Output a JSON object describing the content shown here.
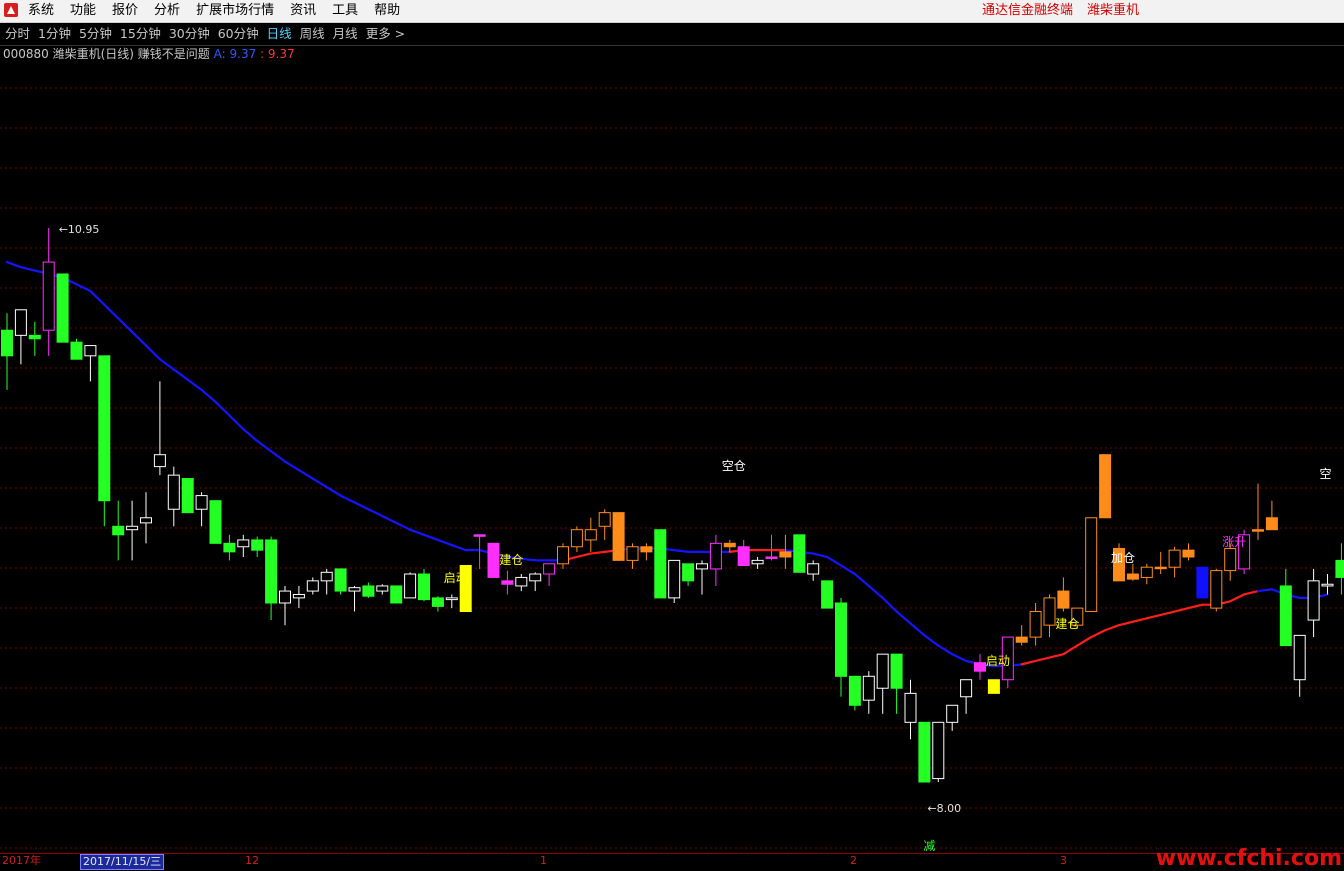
{
  "menubar": {
    "items": [
      "系统",
      "功能",
      "报价",
      "分析",
      "扩展市场行情",
      "资讯",
      "工具",
      "帮助"
    ],
    "brand": "通达信金融终端",
    "stock_name": "潍柴重机"
  },
  "periods": {
    "items": [
      "分时",
      "1分钟",
      "5分钟",
      "15分钟",
      "30分钟",
      "60分钟",
      "日线",
      "周线",
      "月线",
      "更多 >"
    ],
    "active": "日线"
  },
  "info": {
    "code_title": "000880 潍柴重机(日线) 赚钱不是问题",
    "a_label": "A: 9.37",
    "sep_value": " : 9.37"
  },
  "axis": {
    "left_mark": "2017年",
    "selected_date": "2017/11/15/三",
    "month_labels": [
      "12",
      "1",
      "2",
      "3"
    ]
  },
  "watermark": "www.cfchi.com",
  "colors": {
    "up_green": "#24ff24",
    "down_hollow": "#ffffff",
    "magenta": "#ff30ff",
    "yellow": "#ffff00",
    "orange": "#ff8c1a",
    "blue_bar": "#1010ff",
    "ma_blue": "#1414ff",
    "ma_red": "#ff1e1e",
    "grid": "#7a0000",
    "axis_text": "#d02020"
  },
  "chart_data": {
    "type": "candlestick",
    "price_labels": {
      "high": "10.95",
      "low": "8.00",
      "marker_bottom": "减"
    },
    "signal_labels": [
      {
        "text": "启动",
        "color": "#ffff00",
        "index": 32
      },
      {
        "text": "建仓",
        "color": "#ffff00",
        "index": 36
      },
      {
        "text": "空仓",
        "color": "#ffffff",
        "index": 52
      },
      {
        "text": "启动",
        "color": "#ffff00",
        "index": 71
      },
      {
        "text": "建仓",
        "color": "#ffff00",
        "index": 76
      },
      {
        "text": "加仓",
        "color": "#ffffff",
        "index": 80
      },
      {
        "text": "涨升",
        "color": "#ff30ff",
        "index": 88
      },
      {
        "text": "空",
        "color": "#ffffff",
        "index": 95
      }
    ],
    "ylim": [
      7.7,
      11.9
    ],
    "candles": [
      {
        "o": 10.35,
        "h": 10.45,
        "l": 10.0,
        "c": 10.2,
        "k": "green"
      },
      {
        "o": 10.32,
        "h": 10.47,
        "l": 10.15,
        "c": 10.47,
        "k": "hollow"
      },
      {
        "o": 10.3,
        "h": 10.4,
        "l": 10.2,
        "c": 10.32,
        "k": "green"
      },
      {
        "o": 10.35,
        "h": 10.95,
        "l": 10.2,
        "c": 10.75,
        "k": "magenta_hollow"
      },
      {
        "o": 10.68,
        "h": 10.68,
        "l": 10.28,
        "c": 10.28,
        "k": "green"
      },
      {
        "o": 10.28,
        "h": 10.3,
        "l": 10.18,
        "c": 10.18,
        "k": "green"
      },
      {
        "o": 10.2,
        "h": 10.25,
        "l": 10.05,
        "c": 10.26,
        "k": "hollow"
      },
      {
        "o": 10.2,
        "h": 10.2,
        "l": 9.2,
        "c": 9.35,
        "k": "green"
      },
      {
        "o": 9.2,
        "h": 9.35,
        "l": 9.0,
        "c": 9.15,
        "k": "green"
      },
      {
        "o": 9.18,
        "h": 9.35,
        "l": 9.0,
        "c": 9.2,
        "k": "hollow"
      },
      {
        "o": 9.22,
        "h": 9.4,
        "l": 9.1,
        "c": 9.25,
        "k": "hollow"
      },
      {
        "o": 9.55,
        "h": 10.05,
        "l": 9.5,
        "c": 9.62,
        "k": "hollow"
      },
      {
        "o": 9.3,
        "h": 9.55,
        "l": 9.2,
        "c": 9.5,
        "k": "hollow"
      },
      {
        "o": 9.48,
        "h": 9.48,
        "l": 9.28,
        "c": 9.28,
        "k": "green"
      },
      {
        "o": 9.3,
        "h": 9.4,
        "l": 9.2,
        "c": 9.38,
        "k": "hollow"
      },
      {
        "o": 9.35,
        "h": 9.35,
        "l": 9.1,
        "c": 9.1,
        "k": "green"
      },
      {
        "o": 9.1,
        "h": 9.15,
        "l": 9.0,
        "c": 9.05,
        "k": "green"
      },
      {
        "o": 9.08,
        "h": 9.15,
        "l": 9.02,
        "c": 9.12,
        "k": "hollow"
      },
      {
        "o": 9.12,
        "h": 9.14,
        "l": 9.02,
        "c": 9.06,
        "k": "green"
      },
      {
        "o": 9.12,
        "h": 9.14,
        "l": 8.65,
        "c": 8.75,
        "k": "green"
      },
      {
        "o": 8.75,
        "h": 8.85,
        "l": 8.62,
        "c": 8.82,
        "k": "hollow"
      },
      {
        "o": 8.78,
        "h": 8.85,
        "l": 8.72,
        "c": 8.8,
        "k": "hollow"
      },
      {
        "o": 8.82,
        "h": 8.9,
        "l": 8.8,
        "c": 8.88,
        "k": "hollow"
      },
      {
        "o": 8.88,
        "h": 8.95,
        "l": 8.8,
        "c": 8.93,
        "k": "hollow"
      },
      {
        "o": 8.95,
        "h": 8.95,
        "l": 8.8,
        "c": 8.82,
        "k": "green"
      },
      {
        "o": 8.82,
        "h": 8.85,
        "l": 8.7,
        "c": 8.84,
        "k": "hollow"
      },
      {
        "o": 8.85,
        "h": 8.87,
        "l": 8.78,
        "c": 8.79,
        "k": "green"
      },
      {
        "o": 8.82,
        "h": 8.86,
        "l": 8.8,
        "c": 8.85,
        "k": "hollow"
      },
      {
        "o": 8.85,
        "h": 8.85,
        "l": 8.75,
        "c": 8.75,
        "k": "green"
      },
      {
        "o": 8.78,
        "h": 8.93,
        "l": 8.78,
        "c": 8.92,
        "k": "hollow"
      },
      {
        "o": 8.92,
        "h": 8.95,
        "l": 8.76,
        "c": 8.77,
        "k": "green"
      },
      {
        "o": 8.78,
        "h": 8.79,
        "l": 8.7,
        "c": 8.73,
        "k": "green"
      },
      {
        "o": 8.78,
        "h": 8.8,
        "l": 8.72,
        "c": 8.77,
        "k": "hollow"
      },
      {
        "o": 8.7,
        "h": 8.97,
        "l": 8.7,
        "c": 8.97,
        "k": "yellow"
      },
      {
        "o": 9.15,
        "h": 9.15,
        "l": 8.95,
        "c": 9.15,
        "k": "magenta"
      },
      {
        "o": 9.1,
        "h": 9.1,
        "l": 8.9,
        "c": 8.9,
        "k": "magenta"
      },
      {
        "o": 8.86,
        "h": 8.94,
        "l": 8.8,
        "c": 8.88,
        "k": "magenta"
      },
      {
        "o": 8.85,
        "h": 8.92,
        "l": 8.82,
        "c": 8.9,
        "k": "hollow"
      },
      {
        "o": 8.88,
        "h": 8.93,
        "l": 8.82,
        "c": 8.92,
        "k": "hollow"
      },
      {
        "o": 8.92,
        "h": 8.98,
        "l": 8.85,
        "c": 8.98,
        "k": "magenta_hollow"
      },
      {
        "o": 8.98,
        "h": 9.1,
        "l": 8.95,
        "c": 9.08,
        "k": "orange_hollow"
      },
      {
        "o": 9.08,
        "h": 9.2,
        "l": 9.05,
        "c": 9.18,
        "k": "orange_hollow"
      },
      {
        "o": 9.12,
        "h": 9.25,
        "l": 9.05,
        "c": 9.18,
        "k": "orange_hollow"
      },
      {
        "o": 9.2,
        "h": 9.3,
        "l": 9.12,
        "c": 9.28,
        "k": "orange_hollow"
      },
      {
        "o": 9.28,
        "h": 9.28,
        "l": 9.0,
        "c": 9.0,
        "k": "orange"
      },
      {
        "o": 9.0,
        "h": 9.1,
        "l": 8.95,
        "c": 9.08,
        "k": "orange_hollow"
      },
      {
        "o": 9.08,
        "h": 9.1,
        "l": 9.0,
        "c": 9.05,
        "k": "orange"
      },
      {
        "o": 9.18,
        "h": 9.18,
        "l": 8.78,
        "c": 8.78,
        "k": "green"
      },
      {
        "o": 8.78,
        "h": 9.0,
        "l": 8.75,
        "c": 9.0,
        "k": "hollow"
      },
      {
        "o": 8.98,
        "h": 8.98,
        "l": 8.85,
        "c": 8.88,
        "k": "green"
      },
      {
        "o": 8.95,
        "h": 9.0,
        "l": 8.8,
        "c": 8.98,
        "k": "hollow"
      },
      {
        "o": 8.95,
        "h": 9.15,
        "l": 8.85,
        "c": 9.1,
        "k": "magenta_hollow"
      },
      {
        "o": 9.1,
        "h": 9.12,
        "l": 9.05,
        "c": 9.08,
        "k": "orange"
      },
      {
        "o": 9.08,
        "h": 9.12,
        "l": 8.97,
        "c": 8.97,
        "k": "magenta"
      },
      {
        "o": 9.0,
        "h": 9.02,
        "l": 8.95,
        "c": 8.98,
        "k": "hollow"
      },
      {
        "o": 9.02,
        "h": 9.15,
        "l": 9.0,
        "c": 9.02,
        "k": "magenta"
      },
      {
        "o": 9.02,
        "h": 9.15,
        "l": 8.95,
        "c": 9.05,
        "k": "orange"
      },
      {
        "o": 9.15,
        "h": 9.15,
        "l": 8.93,
        "c": 8.93,
        "k": "green"
      },
      {
        "o": 8.92,
        "h": 9.0,
        "l": 8.88,
        "c": 8.98,
        "k": "hollow"
      },
      {
        "o": 8.88,
        "h": 8.88,
        "l": 8.72,
        "c": 8.72,
        "k": "green"
      },
      {
        "o": 8.75,
        "h": 8.78,
        "l": 8.2,
        "c": 8.32,
        "k": "green"
      },
      {
        "o": 8.32,
        "h": 8.32,
        "l": 8.12,
        "c": 8.15,
        "k": "green"
      },
      {
        "o": 8.18,
        "h": 8.35,
        "l": 8.1,
        "c": 8.32,
        "k": "hollow"
      },
      {
        "o": 8.25,
        "h": 8.45,
        "l": 8.1,
        "c": 8.45,
        "k": "hollow"
      },
      {
        "o": 8.45,
        "h": 8.45,
        "l": 8.1,
        "c": 8.25,
        "k": "green"
      },
      {
        "o": 8.22,
        "h": 8.3,
        "l": 7.95,
        "c": 8.05,
        "k": "hollow"
      },
      {
        "o": 8.05,
        "h": 8.05,
        "l": 7.7,
        "c": 7.7,
        "k": "green"
      },
      {
        "o": 7.72,
        "h": 8.05,
        "l": 7.7,
        "c": 8.05,
        "k": "hollow"
      },
      {
        "o": 8.05,
        "h": 8.15,
        "l": 8.0,
        "c": 8.15,
        "k": "hollow"
      },
      {
        "o": 8.2,
        "h": 8.3,
        "l": 8.1,
        "c": 8.3,
        "k": "hollow"
      },
      {
        "o": 8.4,
        "h": 8.45,
        "l": 8.3,
        "c": 8.35,
        "k": "magenta"
      },
      {
        "o": 8.22,
        "h": 8.3,
        "l": 8.22,
        "c": 8.3,
        "k": "yellow"
      },
      {
        "o": 8.3,
        "h": 8.55,
        "l": 8.25,
        "c": 8.55,
        "k": "magenta_hollow"
      },
      {
        "o": 8.55,
        "h": 8.62,
        "l": 8.5,
        "c": 8.52,
        "k": "orange"
      },
      {
        "o": 8.55,
        "h": 8.75,
        "l": 8.5,
        "c": 8.7,
        "k": "orange_hollow"
      },
      {
        "o": 8.62,
        "h": 8.8,
        "l": 8.55,
        "c": 8.78,
        "k": "orange_hollow"
      },
      {
        "o": 8.82,
        "h": 8.9,
        "l": 8.7,
        "c": 8.72,
        "k": "orange"
      },
      {
        "o": 8.62,
        "h": 8.72,
        "l": 8.6,
        "c": 8.72,
        "k": "orange_hollow"
      },
      {
        "o": 8.7,
        "h": 9.25,
        "l": 8.7,
        "c": 9.25,
        "k": "orange_hollow"
      },
      {
        "o": 9.62,
        "h": 9.62,
        "l": 9.25,
        "c": 9.25,
        "k": "orange"
      },
      {
        "o": 9.07,
        "h": 9.1,
        "l": 8.88,
        "c": 8.88,
        "k": "orange"
      },
      {
        "o": 8.92,
        "h": 8.98,
        "l": 8.88,
        "c": 8.89,
        "k": "orange"
      },
      {
        "o": 8.9,
        "h": 8.98,
        "l": 8.86,
        "c": 8.96,
        "k": "orange_hollow"
      },
      {
        "o": 8.96,
        "h": 9.05,
        "l": 8.92,
        "c": 8.96,
        "k": "orange"
      },
      {
        "o": 8.96,
        "h": 9.08,
        "l": 8.9,
        "c": 9.06,
        "k": "orange_hollow"
      },
      {
        "o": 9.06,
        "h": 9.1,
        "l": 9.0,
        "c": 9.02,
        "k": "orange"
      },
      {
        "o": 8.96,
        "h": 8.96,
        "l": 8.78,
        "c": 8.78,
        "k": "blue"
      },
      {
        "o": 8.72,
        "h": 8.95,
        "l": 8.7,
        "c": 8.94,
        "k": "orange_hollow"
      },
      {
        "o": 8.94,
        "h": 9.1,
        "l": 8.88,
        "c": 9.07,
        "k": "orange_hollow"
      },
      {
        "o": 8.95,
        "h": 9.18,
        "l": 8.92,
        "c": 9.15,
        "k": "magenta_hollow"
      },
      {
        "o": 9.18,
        "h": 9.45,
        "l": 9.12,
        "c": 9.18,
        "k": "orange"
      },
      {
        "o": 9.25,
        "h": 9.35,
        "l": 9.18,
        "c": 9.18,
        "k": "orange"
      },
      {
        "o": 8.85,
        "h": 8.95,
        "l": 8.5,
        "c": 8.5,
        "k": "green"
      },
      {
        "o": 8.3,
        "h": 8.56,
        "l": 8.2,
        "c": 8.56,
        "k": "hollow"
      },
      {
        "o": 8.65,
        "h": 8.95,
        "l": 8.55,
        "c": 8.88,
        "k": "hollow"
      },
      {
        "o": 8.86,
        "h": 8.92,
        "l": 8.8,
        "c": 8.85,
        "k": "hollow"
      },
      {
        "o": 8.9,
        "h": 9.1,
        "l": 8.8,
        "c": 9.0,
        "k": "green"
      }
    ],
    "ma": [
      10.75,
      10.72,
      10.7,
      10.68,
      10.66,
      10.62,
      10.58,
      10.5,
      10.42,
      10.34,
      10.26,
      10.18,
      10.12,
      10.06,
      10.0,
      9.93,
      9.85,
      9.77,
      9.7,
      9.64,
      9.58,
      9.53,
      9.48,
      9.43,
      9.38,
      9.34,
      9.3,
      9.26,
      9.22,
      9.18,
      9.15,
      9.12,
      9.09,
      9.06,
      9.06,
      9.04,
      9.02,
      9.01,
      9.0,
      9.0,
      9.0,
      9.02,
      9.04,
      9.05,
      9.06,
      9.07,
      9.07,
      9.07,
      9.06,
      9.05,
      9.05,
      9.05,
      9.05,
      9.06,
      9.06,
      9.06,
      9.06,
      9.05,
      9.04,
      9.02,
      8.97,
      8.92,
      8.85,
      8.78,
      8.7,
      8.63,
      8.56,
      8.5,
      8.45,
      8.41,
      8.39,
      8.38,
      8.38,
      8.39,
      8.41,
      8.43,
      8.45,
      8.5,
      8.55,
      8.59,
      8.62,
      8.64,
      8.66,
      8.68,
      8.7,
      8.72,
      8.74,
      8.74,
      8.76,
      8.8,
      8.82,
      8.83,
      8.8,
      8.78,
      8.78,
      8.8
    ],
    "ma_red_ranges": [
      [
        40,
        44
      ],
      [
        52,
        56
      ],
      [
        73,
        90
      ]
    ]
  }
}
